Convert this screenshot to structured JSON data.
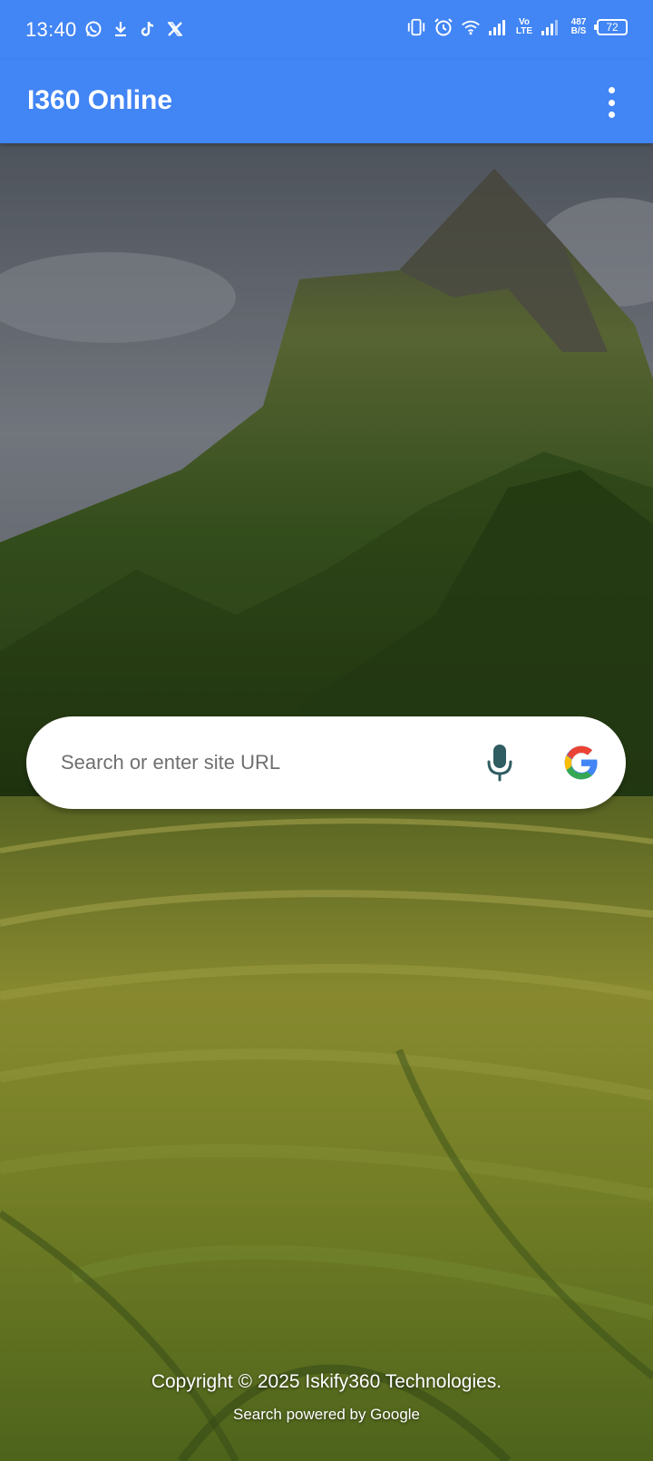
{
  "status_bar": {
    "time": "13:40",
    "volte_line1": "Vo",
    "volte_line2": "LTE",
    "speed_line1": "487",
    "speed_line2": "B/S",
    "battery_level": "72"
  },
  "app_bar": {
    "title": "I360 Online"
  },
  "search": {
    "placeholder": "Search or enter site URL",
    "value": ""
  },
  "footer": {
    "copyright": "Copyright © 2025 Iskify360 Technologies.",
    "powered_by": "Search powered by Google"
  },
  "colors": {
    "app_bar": "#4285f4",
    "mic": "#2f5d62",
    "google_blue": "#4285F4",
    "google_red": "#EA4335",
    "google_yellow": "#FBBC05",
    "google_green": "#34A853"
  },
  "icons": {
    "status_left": [
      "whatsapp-icon",
      "download-icon",
      "tiktok-icon",
      "x-icon"
    ],
    "status_right": [
      "vibrate-icon",
      "alarm-icon",
      "wifi-icon",
      "signal-icon",
      "signal-icon",
      "battery-icon"
    ],
    "app_bar_menu": "more-vert-icon",
    "search_voice": "microphone-icon",
    "search_provider": "google-logo-icon"
  }
}
